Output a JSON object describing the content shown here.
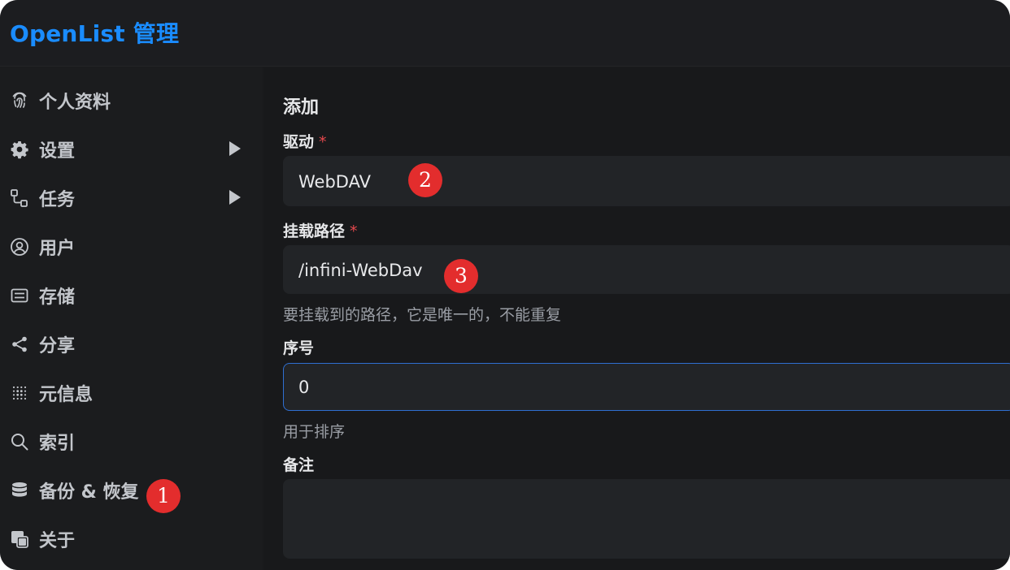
{
  "header": {
    "title": "OpenList 管理"
  },
  "sidebar": {
    "items": [
      {
        "label": "个人资料",
        "icon": "fingerprint-icon",
        "has_submenu": false
      },
      {
        "label": "设置",
        "icon": "gear-icon",
        "has_submenu": true
      },
      {
        "label": "任务",
        "icon": "flow-icon",
        "has_submenu": true
      },
      {
        "label": "用户",
        "icon": "user-circle-icon",
        "has_submenu": false
      },
      {
        "label": "存储",
        "icon": "storage-icon",
        "has_submenu": false
      },
      {
        "label": "分享",
        "icon": "share-icon",
        "has_submenu": false
      },
      {
        "label": "元信息",
        "icon": "meta-icon",
        "has_submenu": false
      },
      {
        "label": "索引",
        "icon": "search-icon",
        "has_submenu": false
      },
      {
        "label": "备份 & 恢复",
        "icon": "database-icon",
        "has_submenu": false
      },
      {
        "label": "关于",
        "icon": "copy-icon",
        "has_submenu": false
      }
    ]
  },
  "form": {
    "title": "添加",
    "driver": {
      "label": "驱动",
      "required_mark": "*",
      "value": "WebDAV"
    },
    "mount_path": {
      "label": "挂载路径",
      "required_mark": "*",
      "value": "/infini-WebDav",
      "help": "要挂载到的路径，它是唯一的，不能重复"
    },
    "order": {
      "label": "序号",
      "value": "0",
      "help": "用于排序"
    },
    "remark": {
      "label": "备注",
      "value": ""
    }
  },
  "annotations": {
    "badge_1": "1",
    "badge_2": "2",
    "badge_3": "3"
  },
  "colors": {
    "accent": "#1a8cff",
    "badge": "#e32d2d",
    "required": "#e5484d",
    "focus_border": "#2f6fd1"
  }
}
